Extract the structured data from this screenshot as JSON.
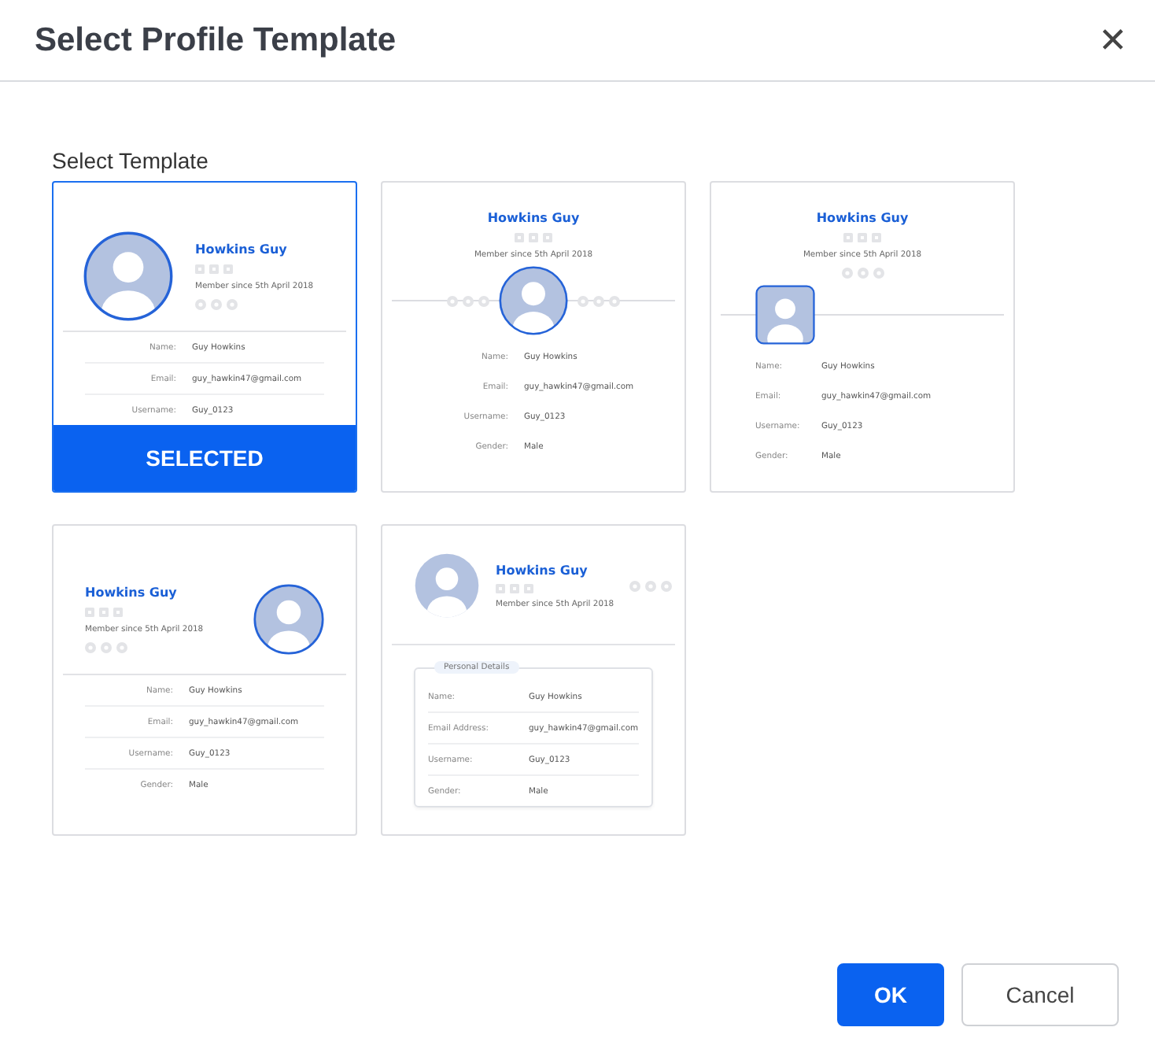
{
  "dialog": {
    "title": "Select Profile Template",
    "close": "✕"
  },
  "section_label": "Select Template",
  "selected_badge": "SELECTED",
  "templates": [
    {
      "kind": "left",
      "selected": true,
      "name": "Howkins Guy",
      "member_since": "Member since 5th April 2018",
      "fields": [
        {
          "label": "Name:",
          "value": "Guy Howkins"
        },
        {
          "label": "Email:",
          "value": "guy_hawkin47@gmail.com"
        },
        {
          "label": "Username:",
          "value": "Guy_0123"
        }
      ]
    },
    {
      "kind": "center",
      "selected": false,
      "name": "Howkins Guy",
      "member_since": "Member since 5th April 2018",
      "fields": [
        {
          "label": "Name:",
          "value": "Guy Howkins"
        },
        {
          "label": "Email:",
          "value": "guy_hawkin47@gmail.com"
        },
        {
          "label": "Username:",
          "value": "Guy_0123"
        },
        {
          "label": "Gender:",
          "value": "Male"
        }
      ]
    },
    {
      "kind": "square",
      "selected": false,
      "name": "Howkins Guy",
      "member_since": "Member since 5th April 2018",
      "fields": [
        {
          "label": "Name:",
          "value": "Guy Howkins"
        },
        {
          "label": "Email:",
          "value": "guy_hawkin47@gmail.com"
        },
        {
          "label": "Username:",
          "value": "Guy_0123"
        },
        {
          "label": "Gender:",
          "value": "Male"
        }
      ]
    },
    {
      "kind": "right",
      "selected": false,
      "name": "Howkins Guy",
      "member_since": "Member since 5th April 2018",
      "fields": [
        {
          "label": "Name:",
          "value": "Guy Howkins"
        },
        {
          "label": "Email:",
          "value": "guy_hawkin47@gmail.com"
        },
        {
          "label": "Username:",
          "value": "Guy_0123"
        },
        {
          "label": "Gender:",
          "value": "Male"
        }
      ]
    },
    {
      "kind": "boxed",
      "selected": false,
      "name": "Howkins Guy",
      "member_since": "Member since 5th April 2018",
      "details_title": "Personal Details",
      "fields": [
        {
          "label": "Name:",
          "value": "Guy Howkins"
        },
        {
          "label": "Email Address:",
          "value": "guy_hawkin47@gmail.com"
        },
        {
          "label": "Username:",
          "value": "Guy_0123"
        },
        {
          "label": "Gender:",
          "value": "Male"
        }
      ]
    }
  ],
  "buttons": [
    {
      "label": "OK",
      "kind": "primary"
    },
    {
      "label": "Cancel",
      "kind": "secondary"
    }
  ]
}
